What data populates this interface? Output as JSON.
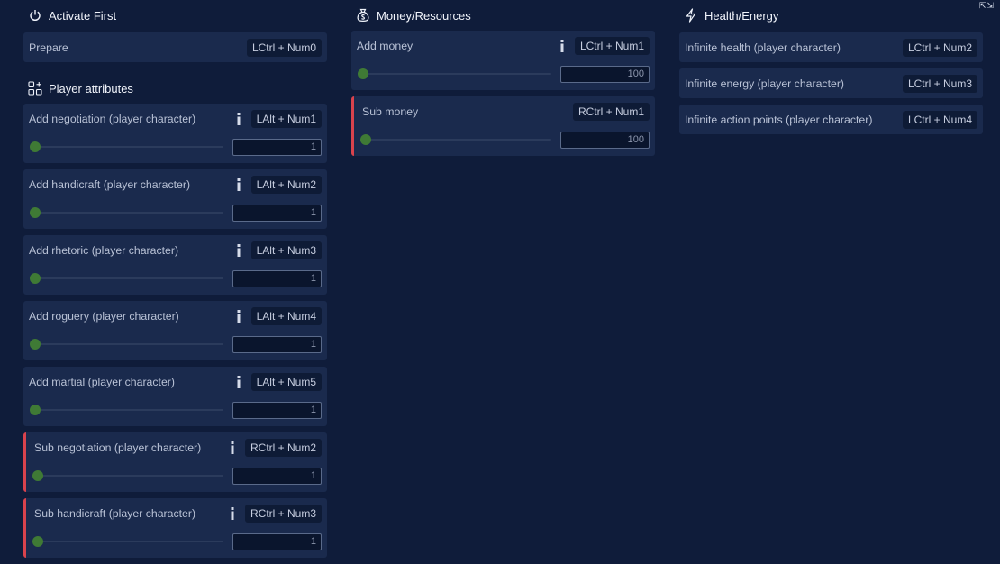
{
  "window": {
    "corner_glyph": "⇱⇲"
  },
  "colors": {
    "background": "#0f1c3a",
    "card": "#1a2a4d",
    "accent": "#d9434d",
    "knob": "#3f7a35"
  },
  "activate": {
    "title": "Activate First",
    "icon": "power-icon",
    "items": [
      {
        "label": "Prepare",
        "hotkey": "LCtrl + Num0"
      }
    ]
  },
  "player": {
    "title": "Player attributes",
    "icon": "grid-add-icon",
    "items": [
      {
        "label": "Add negotiation (player character)",
        "hotkey": "LAlt + Num1",
        "value": "1"
      },
      {
        "label": "Add handicraft (player character)",
        "hotkey": "LAlt + Num2",
        "value": "1"
      },
      {
        "label": "Add rhetoric (player character)",
        "hotkey": "LAlt + Num3",
        "value": "1"
      },
      {
        "label": "Add roguery (player character)",
        "hotkey": "LAlt + Num4",
        "value": "1"
      },
      {
        "label": "Add martial (player character)",
        "hotkey": "LAlt + Num5",
        "value": "1"
      },
      {
        "label": "Sub negotiation (player character)",
        "hotkey": "RCtrl + Num2",
        "value": "1"
      },
      {
        "label": "Sub handicraft (player character)",
        "hotkey": "RCtrl + Num3",
        "value": "1"
      }
    ]
  },
  "money": {
    "title": "Money/Resources",
    "icon": "money-bag-icon",
    "items": [
      {
        "label": "Add money",
        "hotkey": "LCtrl + Num1",
        "value": "100"
      },
      {
        "label": "Sub money",
        "hotkey": "RCtrl + Num1",
        "value": "100"
      }
    ]
  },
  "health": {
    "title": "Health/Energy",
    "icon": "lightning-icon",
    "items": [
      {
        "label": "Infinite health (player character)",
        "hotkey": "LCtrl + Num2"
      },
      {
        "label": "Infinite energy (player character)",
        "hotkey": "LCtrl + Num3"
      },
      {
        "label": "Infinite action points (player character)",
        "hotkey": "LCtrl + Num4"
      }
    ]
  }
}
